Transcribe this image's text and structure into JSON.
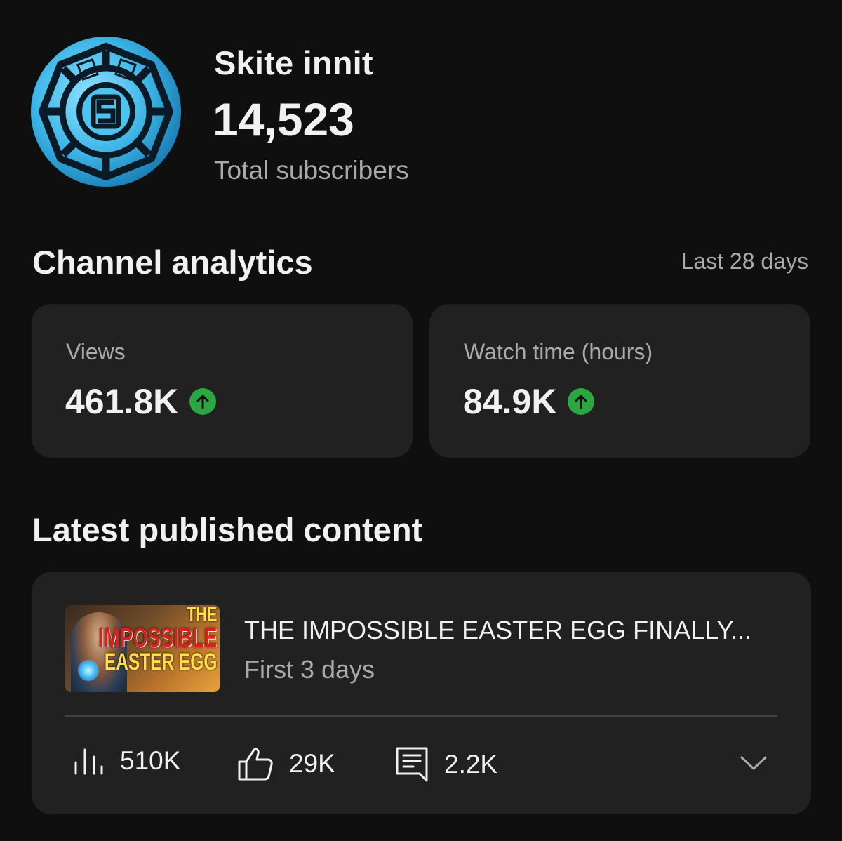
{
  "channel": {
    "name": "Skite innit",
    "subscriber_count": "14,523",
    "subscriber_label": "Total subscribers",
    "avatar_icon": "skite-logo-avatar"
  },
  "analytics": {
    "title": "Channel analytics",
    "period": "Last 28 days",
    "cards": [
      {
        "label": "Views",
        "value": "461.8K",
        "trend": "up",
        "trend_icon": "arrow-up-icon",
        "trend_color": "#2ba640"
      },
      {
        "label": "Watch time (hours)",
        "value": "84.9K",
        "trend": "up",
        "trend_icon": "arrow-up-icon",
        "trend_color": "#2ba640"
      }
    ]
  },
  "latest": {
    "title": "Latest published content",
    "video": {
      "title": "THE IMPOSSIBLE EASTER EGG FINALLY...",
      "subtitle": "First 3 days",
      "thumbnail_text": [
        "THE",
        "IMPOSSIBLE",
        "EASTER EGG"
      ],
      "metrics": {
        "views": "510K",
        "likes": "29K",
        "comments": "2.2K"
      },
      "icons": [
        "bar-chart-icon",
        "thumbs-up-icon",
        "comment-icon",
        "chevron-down-icon"
      ]
    }
  },
  "colors": {
    "background": "#0f0f0f",
    "card": "#212121",
    "secondary_text": "#aaaaaa",
    "positive": "#2ba640"
  }
}
